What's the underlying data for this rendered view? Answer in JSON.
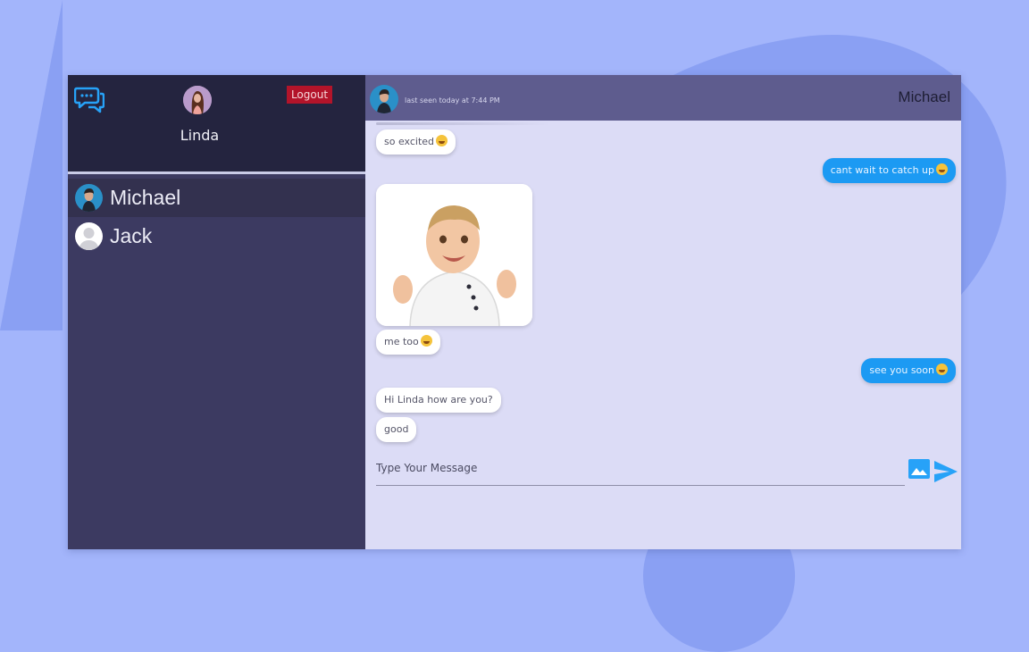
{
  "sidebar": {
    "user_name": "Linda",
    "logout_label": "Logout",
    "contacts": [
      {
        "name": "Michael"
      },
      {
        "name": "Jack"
      }
    ]
  },
  "chat": {
    "contact_name": "Michael",
    "last_seen": "last seen today at 7:44 PM",
    "messages": [
      {
        "direction": "incoming",
        "text": "so excited",
        "emoji": "yum-emoji"
      },
      {
        "direction": "outgoing",
        "text": "cant wait to catch up",
        "emoji": "wink-emoji"
      },
      {
        "direction": "incoming",
        "type": "image",
        "image": "baby-photo"
      },
      {
        "direction": "incoming",
        "text": "me too",
        "emoji": "smile-emoji"
      },
      {
        "direction": "outgoing",
        "text": "see you soon",
        "emoji": "grin-emoji"
      },
      {
        "direction": "incoming",
        "text": "Hi Linda how are you?"
      },
      {
        "direction": "incoming",
        "text": "good"
      }
    ],
    "composer_placeholder": "Type Your Message"
  },
  "colors": {
    "page_background": "#a3b5fb",
    "sidebar": "#3c3a61",
    "sidebar_header": "#24243f",
    "chat_background": "#dcdcf6",
    "chat_header": "#5e5c8e",
    "outgoing_bubble": "#1c9af3",
    "logout_button": "#b3142a",
    "accent_icon": "#27a2f8"
  },
  "icons": {
    "logo": "chat-bubbles-icon",
    "attach_image": "image-icon",
    "send": "send-icon"
  }
}
